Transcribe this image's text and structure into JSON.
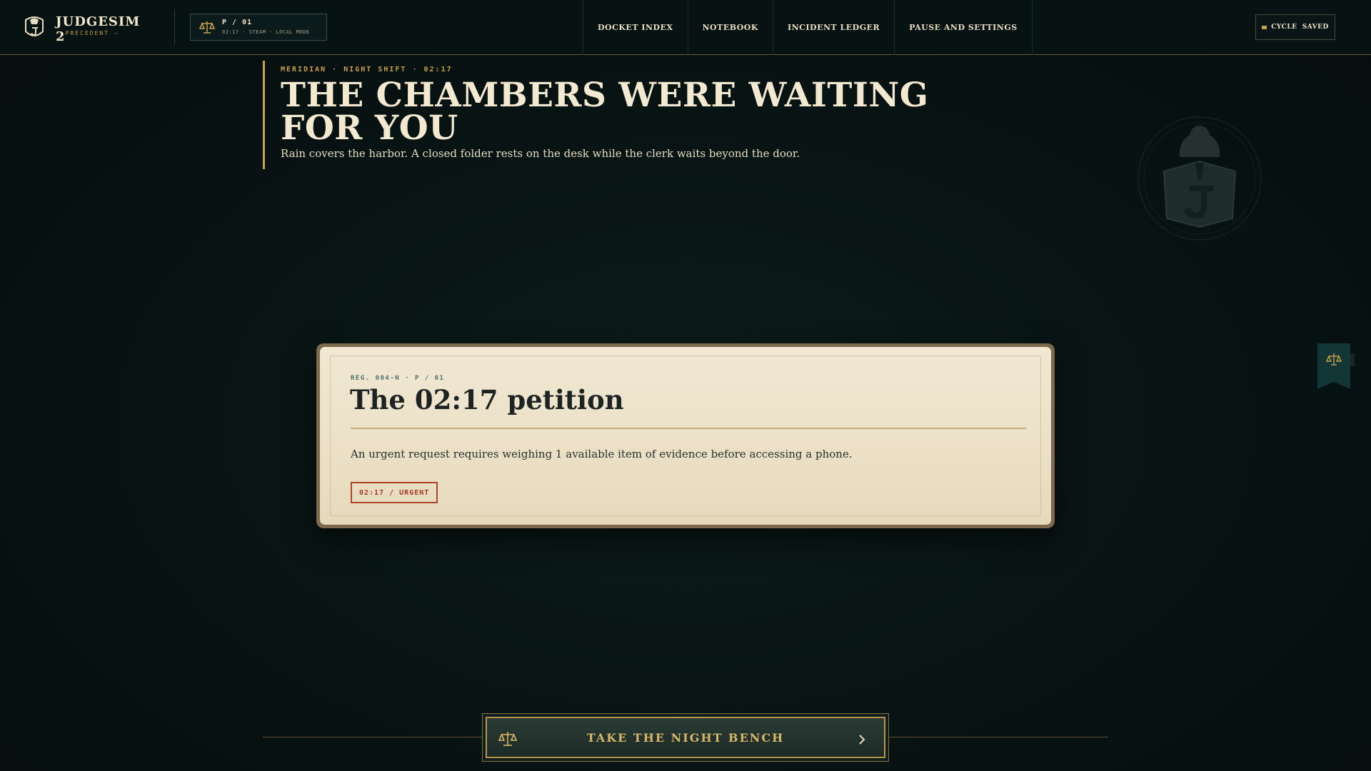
{
  "brand": {
    "title": "JUDGESIM 2",
    "subtitle": "— PRECEDENT —",
    "crest_icon": "judge-crest-icon"
  },
  "session": {
    "code": "P / 01",
    "meta": "02:17 · STEAM · LOCAL MODE",
    "icon": "scales-icon"
  },
  "nav": {
    "items": [
      {
        "label": "DOCKET INDEX"
      },
      {
        "label": "NOTEBOOK"
      },
      {
        "label": "INCIDENT LEDGER"
      },
      {
        "label": "PAUSE AND SETTINGS"
      }
    ]
  },
  "save": {
    "label": "CYCLE  SAVED"
  },
  "hero": {
    "kicker": "MERIDIAN · NIGHT SHIFT · 02:17",
    "headline": "THE CHAMBERS WERE WAITING FOR YOU",
    "lede": "Rain covers the harbor. A closed folder rests on the desk while the clerk waits beyond the door."
  },
  "card": {
    "reg": "REG. 004-N · P / 01",
    "title": "The 02:17 petition",
    "description": "An urgent request requires weighing 1 available item of evidence before accessing a phone.",
    "stamp": "02:17 / URGENT",
    "ribbon_icon": "scales-icon"
  },
  "cta": {
    "label": "TAKE THE NIGHT BENCH",
    "icon": "scales-icon",
    "chevron": "chevron-right-icon"
  },
  "colors": {
    "background": "#081313",
    "accent_gold": "#c9a14a",
    "paper": "#ede3ca",
    "stamp_red": "#b0412d",
    "ribbon_teal": "#123536"
  }
}
